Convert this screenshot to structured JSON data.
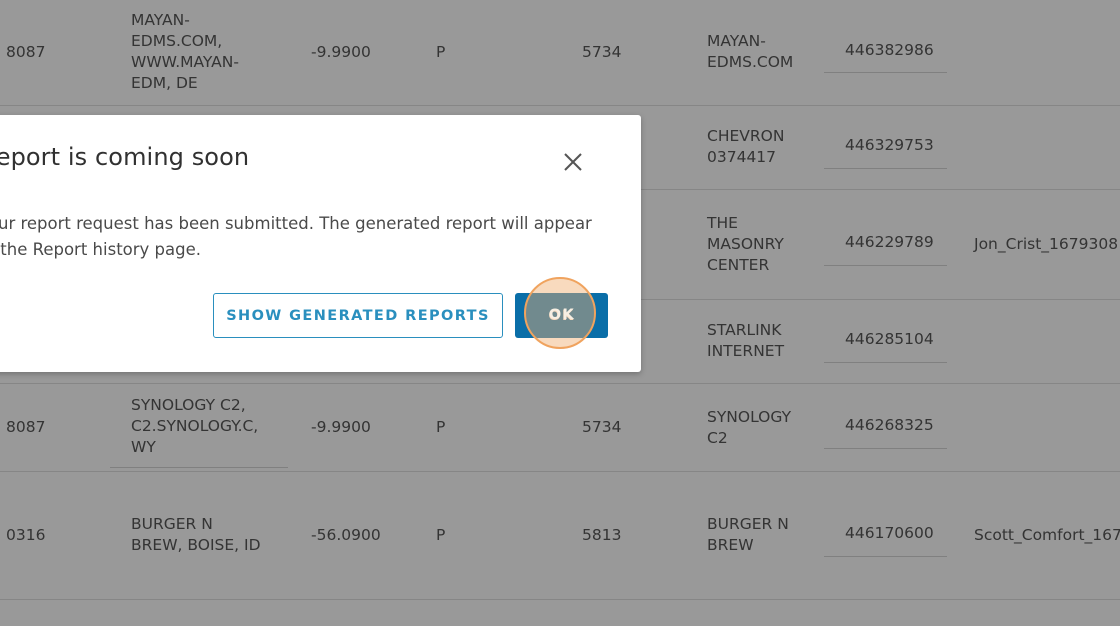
{
  "table": {
    "rows": [
      {
        "account": "8087",
        "merchant": "MAYAN-\nEDMS.COM,\nWWW.MAYAN-\nEDM, DE",
        "amount": "-9.9900",
        "status": "P",
        "mcc": "5734",
        "name": "MAYAN-\nEDMS.COM",
        "txn_id": "446382986",
        "file": ""
      },
      {
        "account": "",
        "merchant": "",
        "amount": "",
        "status": "",
        "mcc": "",
        "name": "CHEVRON\n0374417",
        "txn_id": "446329753",
        "file": ""
      },
      {
        "account": "",
        "merchant": "",
        "amount": "",
        "status": "",
        "mcc": "",
        "name": "THE\nMASONRY\nCENTER",
        "txn_id": "446229789",
        "file": "Jon_Crist_1679308"
      },
      {
        "account": "",
        "merchant": "",
        "amount": "",
        "status": "",
        "mcc": "",
        "name": "STARLINK\nINTERNET",
        "txn_id": "446285104",
        "file": ""
      },
      {
        "account": "8087",
        "merchant": "SYNOLOGY C2,\nC2.SYNOLOGY.C,\nWY",
        "amount": "-9.9900",
        "status": "P",
        "mcc": "5734",
        "name": "SYNOLOGY\nC2",
        "txn_id": "446268325",
        "file": ""
      },
      {
        "account": "0316",
        "merchant": "BURGER N\nBREW, BOISE, ID",
        "amount": "-56.0900",
        "status": "P",
        "mcc": "5813",
        "name": "BURGER N\nBREW",
        "txn_id": "446170600",
        "file": "Scott_Comfort_167"
      }
    ]
  },
  "modal": {
    "title": "Report is coming soon",
    "body": "Your report request has been submitted. The generated report will appear\nin the Report history page.",
    "secondary_label": "SHOW GENERATED REPORTS",
    "primary_label": "OK",
    "close_icon": "close-icon"
  },
  "colors": {
    "accent": "#0a6ea8",
    "outline": "#2a8fbe",
    "focus_ring": "#f0a35e"
  }
}
